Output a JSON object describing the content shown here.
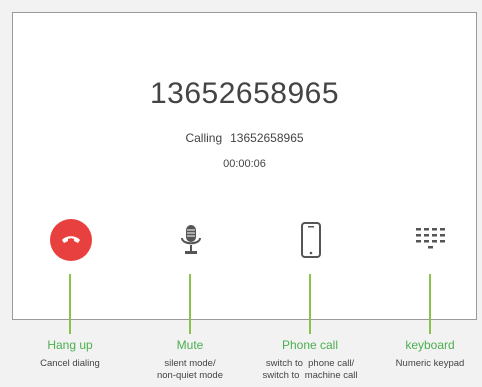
{
  "call": {
    "number": "13652658965",
    "status_label": "Calling",
    "status_number": "13652658965",
    "timer": "00:00:06"
  },
  "controls": [
    {
      "label": "Hang up",
      "desc": [
        "Cancel dialing"
      ],
      "icon": "phone-hangup-icon"
    },
    {
      "label": "Mute",
      "desc": [
        "silent mode/",
        "non-quiet mode"
      ],
      "icon": "microphone-icon"
    },
    {
      "label": "Phone call",
      "desc": [
        "switch to  phone call/",
        "switch to  machine call"
      ],
      "icon": "smartphone-icon"
    },
    {
      "label": "keyboard",
      "desc": [
        "Numeric keypad"
      ],
      "icon": "keypad-icon"
    }
  ],
  "colors": {
    "hangup": "#e8403e",
    "label_green": "#4caf50",
    "line_green": "#8bc34a"
  }
}
